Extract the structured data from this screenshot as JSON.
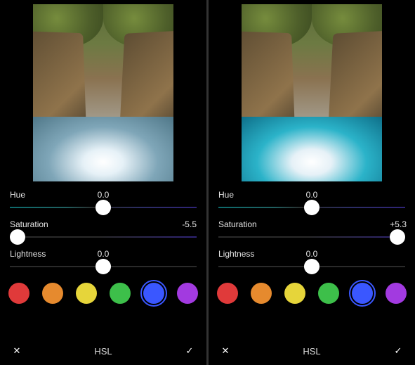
{
  "screens": [
    {
      "hue": {
        "label": "Hue",
        "value": "0.0",
        "thumb_pct": 50
      },
      "saturation": {
        "label": "Saturation",
        "value": "-5.5",
        "thumb_pct": 4
      },
      "lightness": {
        "label": "Lightness",
        "value": "0.0",
        "thumb_pct": 50
      },
      "mode_label": "HSL",
      "swatches": [
        {
          "name": "red",
          "color": "#e03a3a",
          "selected": false
        },
        {
          "name": "orange",
          "color": "#e68a2e",
          "selected": false
        },
        {
          "name": "yellow",
          "color": "#e6d53a",
          "selected": false
        },
        {
          "name": "green",
          "color": "#3dbf4a",
          "selected": false
        },
        {
          "name": "blue",
          "color": "#3a57ff",
          "selected": true
        },
        {
          "name": "purple",
          "color": "#a23ae0",
          "selected": false
        }
      ]
    },
    {
      "hue": {
        "label": "Hue",
        "value": "0.0",
        "thumb_pct": 50
      },
      "saturation": {
        "label": "Saturation",
        "value": "+5.3",
        "thumb_pct": 96
      },
      "lightness": {
        "label": "Lightness",
        "value": "0.0",
        "thumb_pct": 50
      },
      "mode_label": "HSL",
      "swatches": [
        {
          "name": "red",
          "color": "#e03a3a",
          "selected": false
        },
        {
          "name": "orange",
          "color": "#e68a2e",
          "selected": false
        },
        {
          "name": "yellow",
          "color": "#e6d53a",
          "selected": false
        },
        {
          "name": "green",
          "color": "#3dbf4a",
          "selected": false
        },
        {
          "name": "blue",
          "color": "#3a57ff",
          "selected": true
        },
        {
          "name": "purple",
          "color": "#a23ae0",
          "selected": false
        }
      ]
    }
  ],
  "icons": {
    "close": "✕",
    "confirm": "✓"
  }
}
